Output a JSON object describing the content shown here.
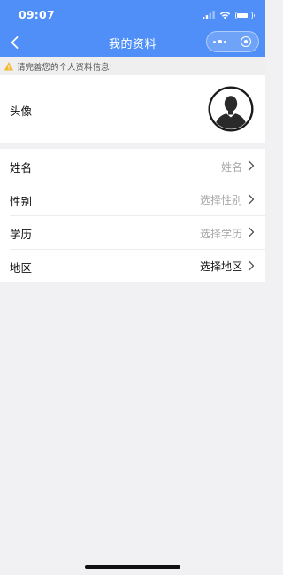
{
  "status_bar": {
    "time": "09:07",
    "battery_level": 0.75
  },
  "nav": {
    "title": "我的资料",
    "back_icon": "chevron-left-icon",
    "more_icon": "more-dots-icon",
    "close_icon": "close-circle-icon"
  },
  "notice": {
    "icon": "warning-icon",
    "text": "请完善您的个人资料信息!"
  },
  "avatar": {
    "label": "头像",
    "icon": "default-user-avatar-icon"
  },
  "form": {
    "rows": [
      {
        "label": "姓名",
        "value": "姓名",
        "is_placeholder": true
      },
      {
        "label": "性别",
        "value": "选择性别",
        "is_placeholder": true
      },
      {
        "label": "学历",
        "value": "选择学历",
        "is_placeholder": true
      },
      {
        "label": "地区",
        "value": "选择地区",
        "is_placeholder": false
      }
    ]
  },
  "colors": {
    "header_blue": "#4f8ff7",
    "page_background": "#f1f1f3",
    "placeholder_gray": "#a8a8a8",
    "warning_yellow": "#f2b931"
  }
}
